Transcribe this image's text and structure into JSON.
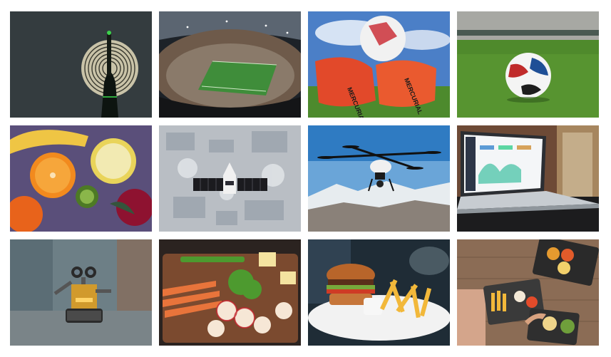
{
  "gallery": {
    "items": [
      {
        "id": "lightpainting-tower",
        "icon": "photo-icon"
      },
      {
        "id": "football-stadium",
        "icon": "photo-icon"
      },
      {
        "id": "boots-and-ball",
        "icon": "photo-icon"
      },
      {
        "id": "ball-on-pitch",
        "icon": "photo-icon"
      },
      {
        "id": "citrus-fruits",
        "icon": "photo-icon"
      },
      {
        "id": "satellite-over-earth",
        "icon": "photo-icon"
      },
      {
        "id": "drone-over-mountains",
        "icon": "photo-icon"
      },
      {
        "id": "laptop-dashboard",
        "icon": "photo-icon"
      },
      {
        "id": "toy-robot",
        "icon": "photo-icon"
      },
      {
        "id": "vegetables-cutting-board",
        "icon": "photo-icon"
      },
      {
        "id": "burger-and-fries",
        "icon": "photo-icon"
      },
      {
        "id": "table-with-snacks",
        "icon": "photo-icon"
      }
    ]
  },
  "tile_text": {
    "boots_brand": "MERCURIAL"
  }
}
